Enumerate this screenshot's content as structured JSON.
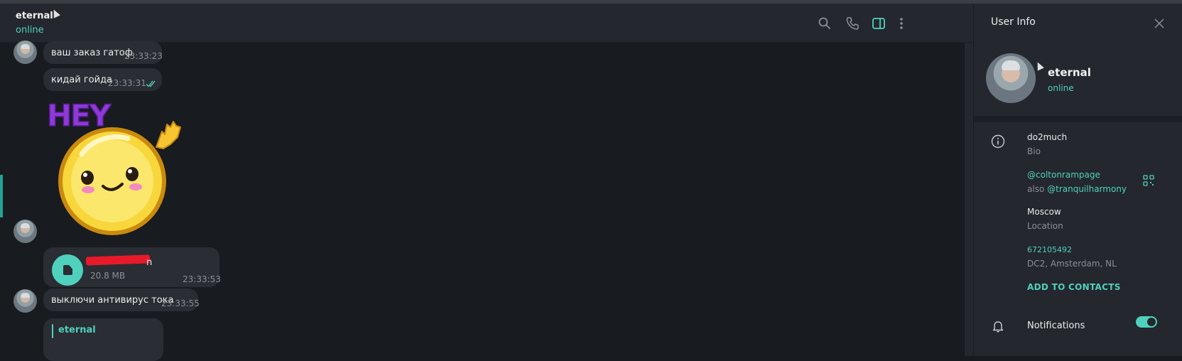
{
  "header": {
    "peer_name": "eternal",
    "peer_status": "online",
    "icons": [
      "search-icon",
      "phone-icon",
      "sidebar-toggle-icon",
      "more-vertical-icon"
    ]
  },
  "messages": [
    {
      "type": "text",
      "text": "ваш заказ гатоф",
      "time": "23:33:23"
    },
    {
      "type": "text",
      "text": "кидай гойда",
      "time": "23:33:31",
      "status": "read"
    },
    {
      "type": "sticker",
      "text": "HEY",
      "description": "waving smiley sticker"
    },
    {
      "type": "file",
      "name_visible_suffix": "n",
      "size": "20.8 MB",
      "time": "23:33:53"
    },
    {
      "type": "text",
      "text": "выключи антивирус тока",
      "time": "23:33:55"
    },
    {
      "type": "reply",
      "reply_to": "eternal"
    }
  ],
  "panel": {
    "title": "User Info",
    "name": "eternal",
    "status": "online",
    "bio": {
      "value": "do2much",
      "label": "Bio"
    },
    "username": {
      "value": "@coltonrampage",
      "also_prefix": "also",
      "also": "@tranquilharmony"
    },
    "location": {
      "value": "Moscow",
      "label": "Location"
    },
    "id": {
      "value": "672105492",
      "dc": "DC2, Amsterdam, NL"
    },
    "add_contact": "ADD TO CONTACTS",
    "notifications": {
      "label": "Notifications",
      "enabled": true
    }
  },
  "colors": {
    "accent": "#4fd1bd",
    "background": "#181b20",
    "panel": "#24272d",
    "bubble": "#2a2d33"
  }
}
